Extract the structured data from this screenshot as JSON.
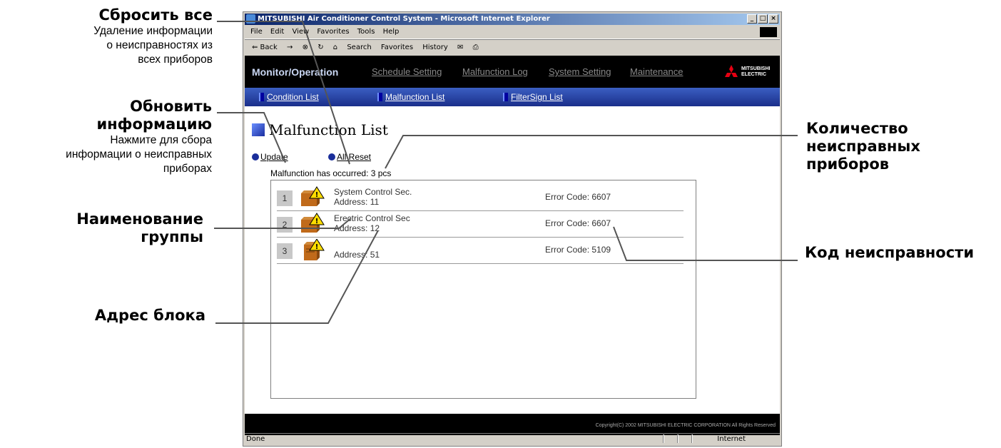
{
  "annotations": {
    "reset_all": {
      "title": "Сбросить все",
      "desc": [
        "Удаление информации",
        "о неисправностях из",
        "всех приборов"
      ]
    },
    "update": {
      "title": [
        "Обновить",
        "информацию"
      ],
      "desc": [
        "Нажмите для сбора",
        "информации о неисправных",
        "приборах"
      ]
    },
    "group_name": {
      "title": [
        "Наименование",
        "группы"
      ]
    },
    "unit_address": {
      "title": "Адрес блока"
    },
    "count": {
      "title": [
        "Количество",
        "неисправных",
        "приборов"
      ]
    },
    "error_code": {
      "title": "Код неисправности"
    }
  },
  "browser": {
    "title": "MITSUBISHI Air Conditioner Control System - Microsoft Internet Explorer",
    "menu": [
      "File",
      "Edit",
      "View",
      "Favorites",
      "Tools",
      "Help"
    ],
    "toolbar": [
      "⇐ Back",
      "→",
      "Search",
      "Favorites",
      "History"
    ],
    "status_left": "Done",
    "status_right": "Internet"
  },
  "nav": {
    "main": [
      "Monitor/Operation",
      "Schedule Setting",
      "Malfunction Log",
      "System Setting",
      "Maintenance"
    ],
    "sub": [
      "Condition List",
      "Malfunction List",
      "FilterSign List"
    ],
    "logo": [
      "MITSUBISHI",
      "ELECTRIC"
    ]
  },
  "page": {
    "title": "Malfunction List",
    "update_link": "Update",
    "all_reset_link": "All Reset",
    "count_text": "Malfunction has occurred: 3 pcs",
    "rows": [
      {
        "num": "1",
        "name": "System Control Sec.",
        "address": "Address: 11",
        "error": "Error Code: 6607"
      },
      {
        "num": "2",
        "name": "Erectric Control Sec",
        "address": "Address: 12",
        "error": "Error Code: 6607"
      },
      {
        "num": "3",
        "name": "",
        "address": "Address: 51",
        "error": "Error Code: 5109"
      }
    ],
    "copyright": "Copyright(C) 2002 MITSUBISHI ELECTRIC CORPORATION All Rights Reserved"
  }
}
